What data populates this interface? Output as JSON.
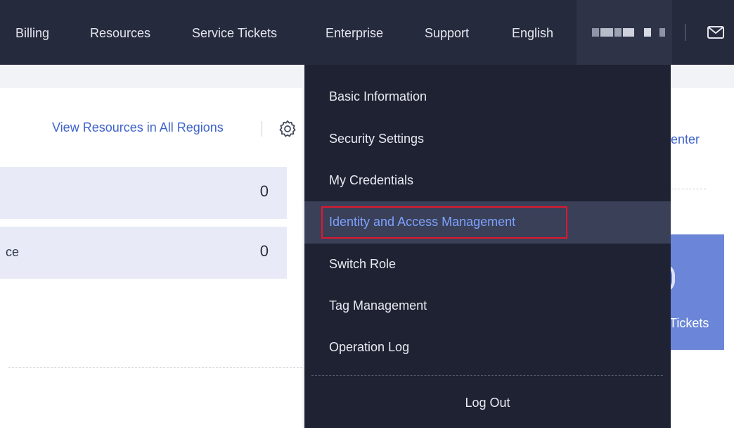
{
  "topbar": {
    "nav": [
      "Billing",
      "Resources",
      "Service Tickets",
      "Enterprise",
      "Support",
      "English"
    ],
    "account_icon": "account-name-redacted",
    "mail_icon": "mail-icon"
  },
  "resources_panel": {
    "view_all_link": "View Resources in All Regions",
    "settings_icon": "gear-icon",
    "rows": [
      {
        "label": "",
        "count": "0"
      },
      {
        "label": "ce",
        "count": "0"
      }
    ]
  },
  "right_panel": {
    "center_link": "enter",
    "tickets_label": "Tickets",
    "card_color": "#6b86d8"
  },
  "account_menu": {
    "items": [
      "Basic Information",
      "Security Settings",
      "My Credentials",
      "Identity and Access Management",
      "Switch Role",
      "Tag Management",
      "Operation Log"
    ],
    "active_index": 3,
    "highlight_color": "#e0182f",
    "active_text_color": "#7da1ff",
    "logout_label": "Log Out"
  },
  "colors": {
    "topbar_bg": "#262a3d",
    "menu_bg": "#1f2232",
    "link": "#3f64c9"
  }
}
